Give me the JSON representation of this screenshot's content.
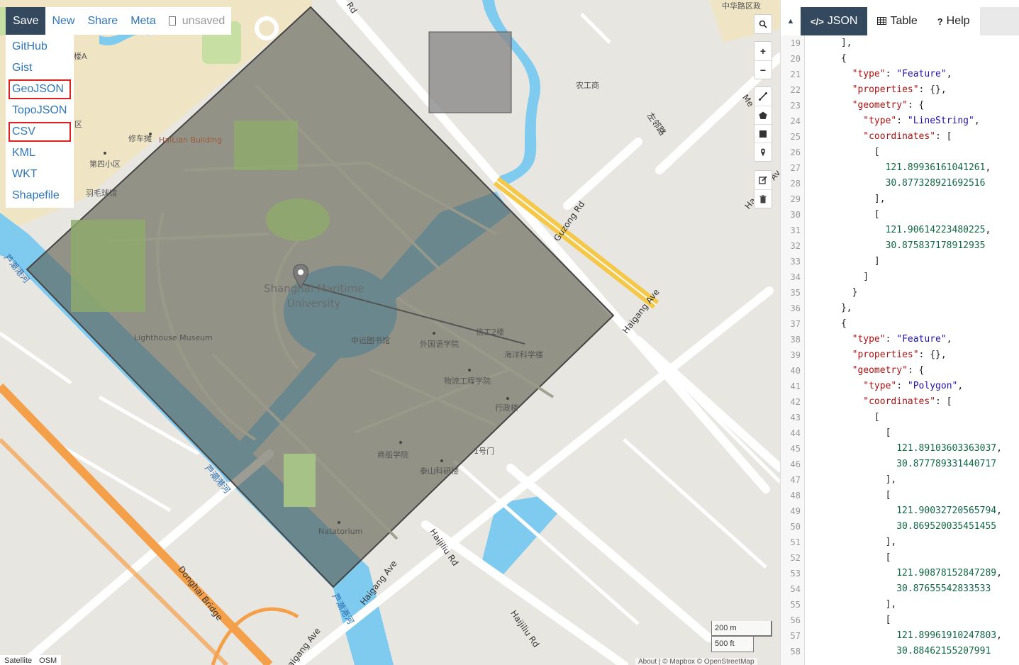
{
  "toolbar": {
    "save_label": "Save",
    "new_label": "New",
    "share_label": "Share",
    "meta_label": "Meta",
    "file_status": "unsaved"
  },
  "save_menu": {
    "items": [
      {
        "label": "GitHub",
        "highlighted": false
      },
      {
        "label": "Gist",
        "highlighted": false
      },
      {
        "label": "GeoJSON",
        "highlighted": true
      },
      {
        "label": "TopoJSON",
        "highlighted": false
      },
      {
        "label": "CSV",
        "highlighted": true
      },
      {
        "label": "KML",
        "highlighted": false
      },
      {
        "label": "WKT",
        "highlighted": false
      },
      {
        "label": "Shapefile",
        "highlighted": false
      }
    ],
    "highlight_color": "#e0201f"
  },
  "map": {
    "labels": {
      "university": "Shanghai Maritime\nUniversity",
      "lighthouse": "Lighthouse Museum",
      "library": "中远图书馆",
      "foreign_lang": "外国语学院",
      "marine": "海洋科学楼",
      "logistics": "物流工程学院",
      "admin": "行政楼",
      "ship": "商船学院",
      "taishan": "泰山科研楼",
      "gate": "1号门",
      "natatorium": "Natatorium",
      "eng2": "信工2楼",
      "hailian": "HaiLian Building",
      "repair": "修车摊",
      "district4": "第四小区",
      "badminton": "羽毛球馆",
      "district": "区",
      "block_a": "楼A",
      "nonggong": "农工商",
      "zuoxing": "左邻路",
      "guzong": "Guzong Rd",
      "haigang1": "Haigang Ave",
      "haigang2": "Haigang Ave",
      "haigang3": "Haigang Ave",
      "haijiliu1": "Haijiliu Rd",
      "haijiliu2": "Haijiliu Rd",
      "donghai": "Donghai Bridge",
      "river1": "芦潮港河",
      "river2": "芦潮港河",
      "river3": "芦潮港河",
      "top_text": "中华路区政",
      "road_rd": "Rd",
      "road_me": "Me",
      "road_ha": "Ha",
      "road_av": "Av"
    },
    "colors": {
      "land": "#e8e6e1",
      "water": "#7fcbef",
      "park": "#c8dfa3",
      "sand": "#efe5c5",
      "polygon_fill": "#5a5a4a",
      "highway": "#f5c84a",
      "bridge": "#f4a04a"
    },
    "scale": {
      "metric": "200 m",
      "imperial": "500 ft"
    },
    "layers": [
      "Satellite",
      "OSM"
    ],
    "attribution": "About | © Mapbox © OpenStreetMap"
  },
  "controls": {
    "search": "search-icon",
    "zoom_in": "+",
    "zoom_out": "−"
  },
  "panel": {
    "tabs": [
      {
        "label": "JSON",
        "icon": "</>",
        "active": true
      },
      {
        "label": "Table",
        "icon": "table-icon",
        "active": false
      },
      {
        "label": "Help",
        "icon": "?",
        "active": false
      }
    ],
    "code_lines": [
      {
        "n": "19",
        "t": "      ],"
      },
      {
        "n": "20",
        "t": "      {"
      },
      {
        "n": "21",
        "t": "        \"type\": \"Feature\","
      },
      {
        "n": "22",
        "t": "        \"properties\": {},"
      },
      {
        "n": "23",
        "t": "        \"geometry\": {"
      },
      {
        "n": "24",
        "t": "          \"type\": \"LineString\","
      },
      {
        "n": "25",
        "t": "          \"coordinates\": ["
      },
      {
        "n": "26",
        "t": "            ["
      },
      {
        "n": "27",
        "t": "              121.89936161041261,"
      },
      {
        "n": "28",
        "t": "              30.877328921692516"
      },
      {
        "n": "29",
        "t": "            ],"
      },
      {
        "n": "30",
        "t": "            ["
      },
      {
        "n": "31",
        "t": "              121.90614223480225,"
      },
      {
        "n": "32",
        "t": "              30.875837178912935"
      },
      {
        "n": "33",
        "t": "            ]"
      },
      {
        "n": "34",
        "t": "          ]"
      },
      {
        "n": "35",
        "t": "        }"
      },
      {
        "n": "36",
        "t": "      },"
      },
      {
        "n": "37",
        "t": "      {"
      },
      {
        "n": "38",
        "t": "        \"type\": \"Feature\","
      },
      {
        "n": "39",
        "t": "        \"properties\": {},"
      },
      {
        "n": "40",
        "t": "        \"geometry\": {"
      },
      {
        "n": "41",
        "t": "          \"type\": \"Polygon\","
      },
      {
        "n": "42",
        "t": "          \"coordinates\": ["
      },
      {
        "n": "43",
        "t": "            ["
      },
      {
        "n": "44",
        "t": "              ["
      },
      {
        "n": "45",
        "t": "                121.89103603363037,"
      },
      {
        "n": "46",
        "t": "                30.877789331440717"
      },
      {
        "n": "47",
        "t": "              ],"
      },
      {
        "n": "48",
        "t": "              ["
      },
      {
        "n": "49",
        "t": "                121.90032720565794,"
      },
      {
        "n": "50",
        "t": "                30.869520035451455"
      },
      {
        "n": "51",
        "t": "              ],"
      },
      {
        "n": "52",
        "t": "              ["
      },
      {
        "n": "53",
        "t": "                121.90878152847289,"
      },
      {
        "n": "54",
        "t": "                30.87655542833533"
      },
      {
        "n": "55",
        "t": "              ],"
      },
      {
        "n": "56",
        "t": "              ["
      },
      {
        "n": "57",
        "t": "                121.89961910247803,"
      },
      {
        "n": "58",
        "t": "                30.88462155207991"
      }
    ]
  }
}
